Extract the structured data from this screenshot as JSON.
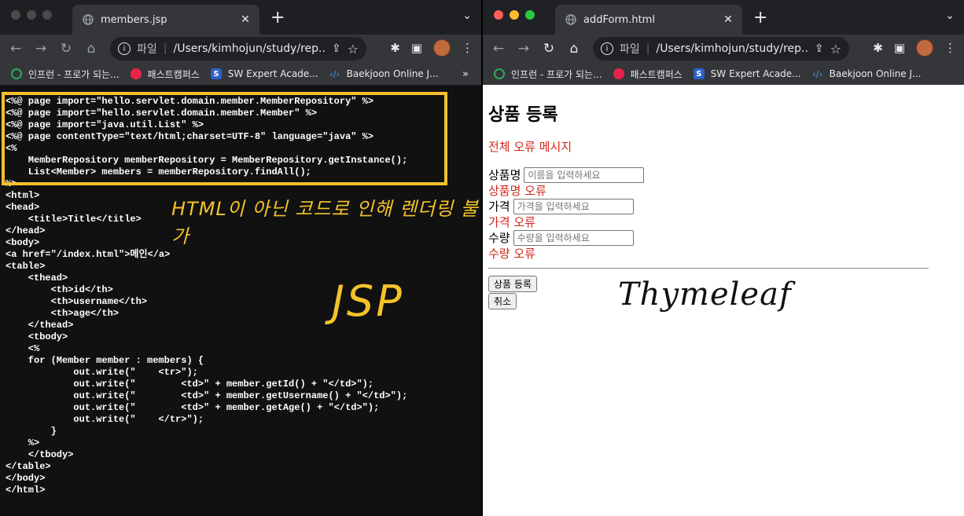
{
  "left_window": {
    "tab_title": "members.jsp",
    "address": {
      "scheme_label": "파일",
      "url": "/Users/kimhojun/study/rep..."
    },
    "bookmarks": [
      {
        "label": "인프런 - 프로가 되는...",
        "icon": "inflearn-icon",
        "color": "#2aab5e"
      },
      {
        "label": "패스트캠퍼스",
        "icon": "fastcampus-icon",
        "color": "#e8234a"
      },
      {
        "label": "SW Expert Acade...",
        "icon": "sw-expert-icon",
        "color": "#2a62c9"
      },
      {
        "label": "Baekjoon Online J...",
        "icon": "code-icon",
        "color": "#3f88d6"
      }
    ],
    "code_highlighted": "<%@ page import=\"hello.servlet.domain.member.MemberRepository\" %>\n<%@ page import=\"hello.servlet.domain.member.Member\" %>\n<%@ page import=\"java.util.List\" %>\n<%@ page contentType=\"text/html;charset=UTF-8\" language=\"java\" %>\n<%\n    MemberRepository memberRepository = MemberRepository.getInstance();\n    List<Member> members = memberRepository.findAll();\n%>",
    "code_rest": "<html>\n<head>\n    <title>Title</title>\n</head>\n<body>\n<a href=\"/index.html\">메인</a>\n<table>\n    <thead>\n        <th>id</th>\n        <th>username</th>\n        <th>age</th>\n    </thead>\n    <tbody>\n    <%\n    for (Member member : members) {\n            out.write(\"    <tr>\");\n            out.write(\"        <td>\" + member.getId() + \"</td>\");\n            out.write(\"        <td>\" + member.getUsername() + \"</td>\");\n            out.write(\"        <td>\" + member.getAge() + \"</td>\");\n            out.write(\"    </tr>\");\n        }\n    %>\n    </tbody>\n</table>\n</body>\n</html>",
    "annotation_text": "HTML이 아닌 코드로 인해 렌더링 불가",
    "annotation_label": "JSP",
    "highlight_color": "#f7c02a"
  },
  "right_window": {
    "tab_title": "addForm.html",
    "address": {
      "scheme_label": "파일",
      "url": "/Users/kimhojun/study/rep..."
    },
    "bookmarks": [
      {
        "label": "인프런 - 프로가 되는...",
        "icon": "inflearn-icon",
        "color": "#2aab5e"
      },
      {
        "label": "패스트캠퍼스",
        "icon": "fastcampus-icon",
        "color": "#e8234a"
      },
      {
        "label": "SW Expert Acade...",
        "icon": "sw-expert-icon",
        "color": "#2a62c9"
      },
      {
        "label": "Baekjoon Online J...",
        "icon": "code-icon",
        "color": "#3f88d6"
      }
    ],
    "page": {
      "heading": "상품 등록",
      "global_error": "전체 오류 메시지",
      "fields": [
        {
          "label": "상품명",
          "placeholder": "이름을 입력하세요",
          "error": "상품명 오류"
        },
        {
          "label": "가격",
          "placeholder": "가격을 입력하세요",
          "error": "가격 오류"
        },
        {
          "label": "수량",
          "placeholder": "수량을 입력하세요",
          "error": "수량 오류"
        }
      ],
      "submit_label": "상품 등록",
      "cancel_label": "취소",
      "error_color": "#d0271a"
    },
    "annotation_label": "Thymeleaf"
  }
}
